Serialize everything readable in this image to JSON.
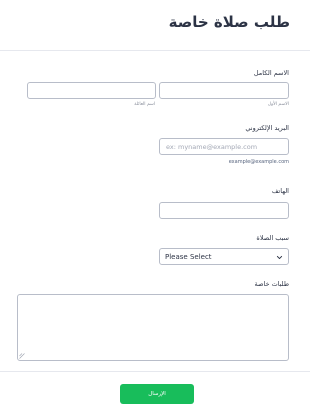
{
  "form": {
    "title": "طلب صلاة خاصة",
    "full_name": {
      "label": "الاسم الكامل",
      "first_sublabel": "الاسم الأول",
      "last_sublabel": "اسم العائلة",
      "first_value": "",
      "last_value": ""
    },
    "email": {
      "label": "البريد الإلكتروني",
      "placeholder": "ex: myname@example.com",
      "hint": "example@example.com",
      "value": ""
    },
    "phone": {
      "label": "الهاتف",
      "value": ""
    },
    "reason": {
      "label": "سبب الصلاة",
      "selected": "Please Select"
    },
    "notes": {
      "label": "طلبات خاصة",
      "value": ""
    },
    "submit_label": "الإرسال"
  },
  "colors": {
    "submit": "#18bd5b",
    "text": "#2c3345",
    "border": "#b8bdc9"
  },
  "icons": {
    "select_arrow": "chevron-down-icon",
    "textarea_resize": "resize-grip-icon"
  }
}
